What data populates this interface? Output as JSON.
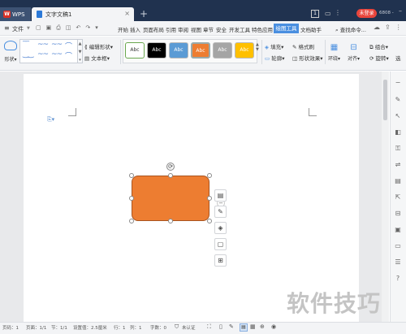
{
  "titlebar": {
    "app_tab_label": "WPS",
    "doc_tab_label": "文字文稿1",
    "page_badge": "1",
    "login_label": "未登录",
    "user_id": "6808 -"
  },
  "menubar": {
    "file_label": "文件",
    "items": [
      "开始",
      "插入",
      "页面布局",
      "引用",
      "审阅",
      "视图",
      "章节",
      "安全",
      "开发工具",
      "特色应用"
    ],
    "active_tab": "绘图工具",
    "extra_tab": "文档助手",
    "search_label": "查找命令..."
  },
  "ribbon": {
    "shape_label": "形状",
    "edit_shape_label": "编辑形状",
    "text_box_label": "文本框",
    "styles": [
      "Abc",
      "Abc",
      "Abc",
      "Abc",
      "Abc",
      "Abc"
    ],
    "fill_label": "填充",
    "format_painter_label": "格式刷",
    "outline_label": "轮廓",
    "shape_effect_label": "形状效果",
    "wrap_label": "环绕",
    "align_label": "对齐",
    "group_label": "组合",
    "rotate_label": "旋转",
    "more_label": "选"
  },
  "statusbar": {
    "page_num": "页码：1",
    "page_of": "页面：1/1",
    "section": "节：1/1",
    "setting": "设置值：2.5厘米",
    "row": "行：1",
    "col": "列：1",
    "word_count": "字数：0",
    "auth": "未认证"
  },
  "watermark": "软件技巧",
  "colors": {
    "titlebar": "#20324f",
    "accent": "#4a8fe0",
    "shape_fill": "#ed7d31"
  }
}
